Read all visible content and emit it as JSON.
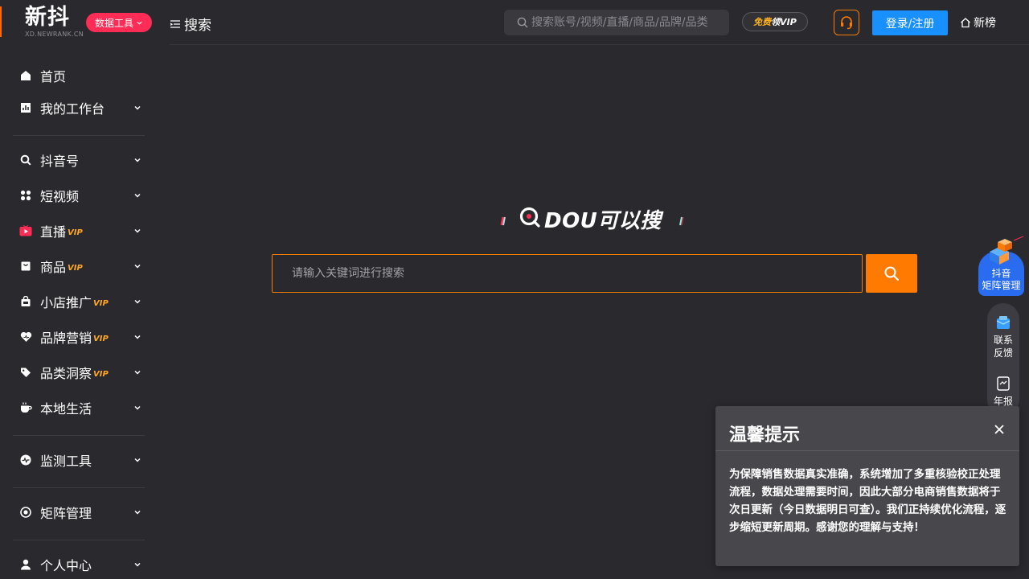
{
  "header": {
    "logo_main": "新抖",
    "logo_sub": "XD.NEWRANK.CN",
    "tools_badge": "数据工具",
    "page_title": "搜索",
    "search_placeholder": "搜索账号/视频/直播/商品/品牌/品类",
    "vip_promo_part1": "免费",
    "vip_promo_part2": "领VIP",
    "login_label": "登录/注册",
    "xinbang_label": "新榜"
  },
  "sidebar": {
    "items": [
      {
        "label": "首页",
        "icon": "home-icon",
        "vip": ""
      },
      {
        "label": "我的工作台",
        "icon": "dashboard-icon",
        "vip": ""
      },
      {
        "label": "抖音号",
        "icon": "search-icon",
        "vip": ""
      },
      {
        "label": "短视频",
        "icon": "grid-icon",
        "vip": ""
      },
      {
        "label": "直播",
        "icon": "live-tv-icon",
        "vip": "VIP"
      },
      {
        "label": "商品",
        "icon": "bag-icon",
        "vip": "VIP"
      },
      {
        "label": "小店推广",
        "icon": "shop-icon",
        "vip": "VIP"
      },
      {
        "label": "品牌营销",
        "icon": "heart-icon",
        "vip": "VIP"
      },
      {
        "label": "品类洞察",
        "icon": "tag-icon",
        "vip": "VIP"
      },
      {
        "label": "本地生活",
        "icon": "coffee-icon",
        "vip": ""
      },
      {
        "label": "监测工具",
        "icon": "monitor-icon",
        "vip": ""
      },
      {
        "label": "矩阵管理",
        "icon": "matrix-icon",
        "vip": ""
      },
      {
        "label": "个人中心",
        "icon": "user-icon",
        "vip": ""
      }
    ]
  },
  "main": {
    "brand_text": "DOU可以搜",
    "search_placeholder": "请输入关键词进行搜索"
  },
  "floating": {
    "matrix_line1": "抖音",
    "matrix_line2": "矩阵管理",
    "contact_line1": "联系",
    "contact_line2": "反馈",
    "report_label": "年报"
  },
  "notice": {
    "title": "温馨提示",
    "body": "为保障销售数据真实准确，系统增加了多重核验校正处理流程，数据处理需要时间，因此大部分电商销售数据将于次日更新（今日数据明日可查）。我们正持续优化流程，逐步缩短更新周期。感谢您的理解与支持！"
  },
  "colors": {
    "accent_orange": "#ff7a00",
    "badge_pink": "#ff2d55",
    "login_blue": "#1890ff",
    "vip_gold": "#ffa726",
    "background": "#2a292e"
  }
}
